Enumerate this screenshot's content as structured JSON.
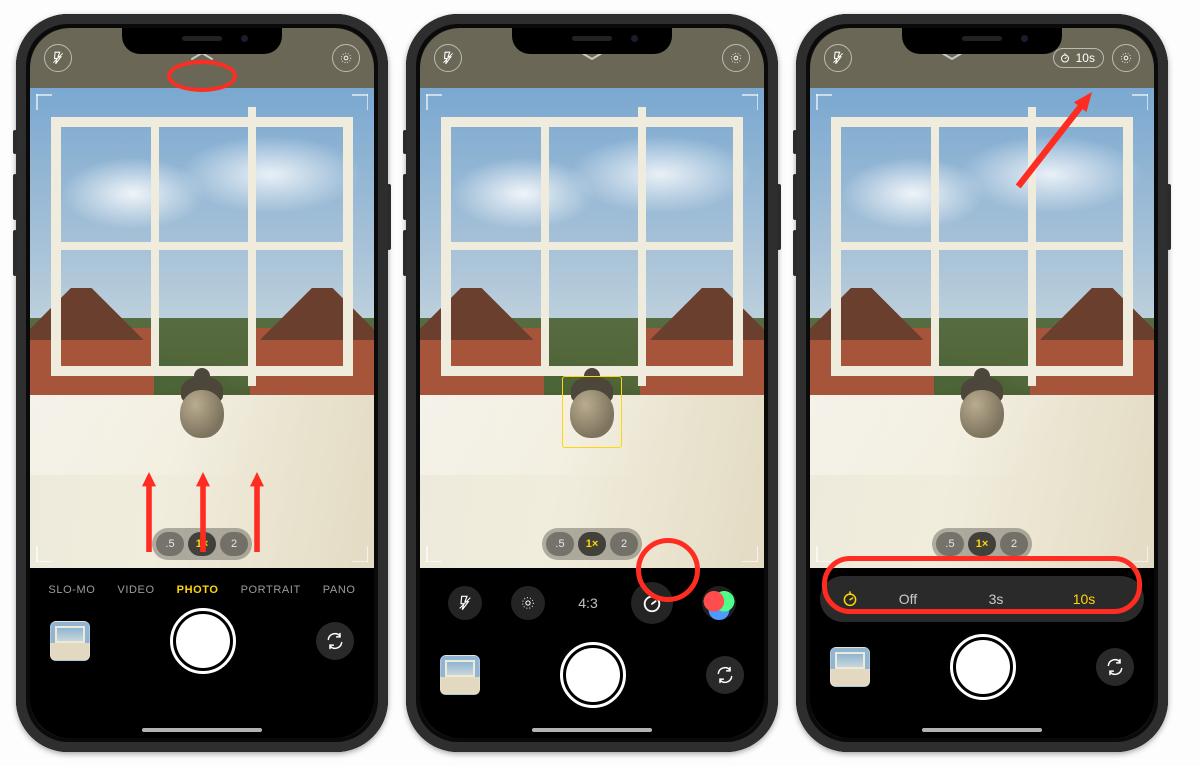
{
  "zoom": {
    "wide": ".5",
    "default": "1×",
    "tele": "2"
  },
  "modes": {
    "slomo": "SLO-MO",
    "video": "VIDEO",
    "photo": "PHOTO",
    "portrait": "PORTRAIT",
    "pano": "PANO"
  },
  "tools": {
    "aspect": "4:3"
  },
  "timer": {
    "off": "Off",
    "three": "3s",
    "ten": "10s",
    "badge": "10s"
  }
}
